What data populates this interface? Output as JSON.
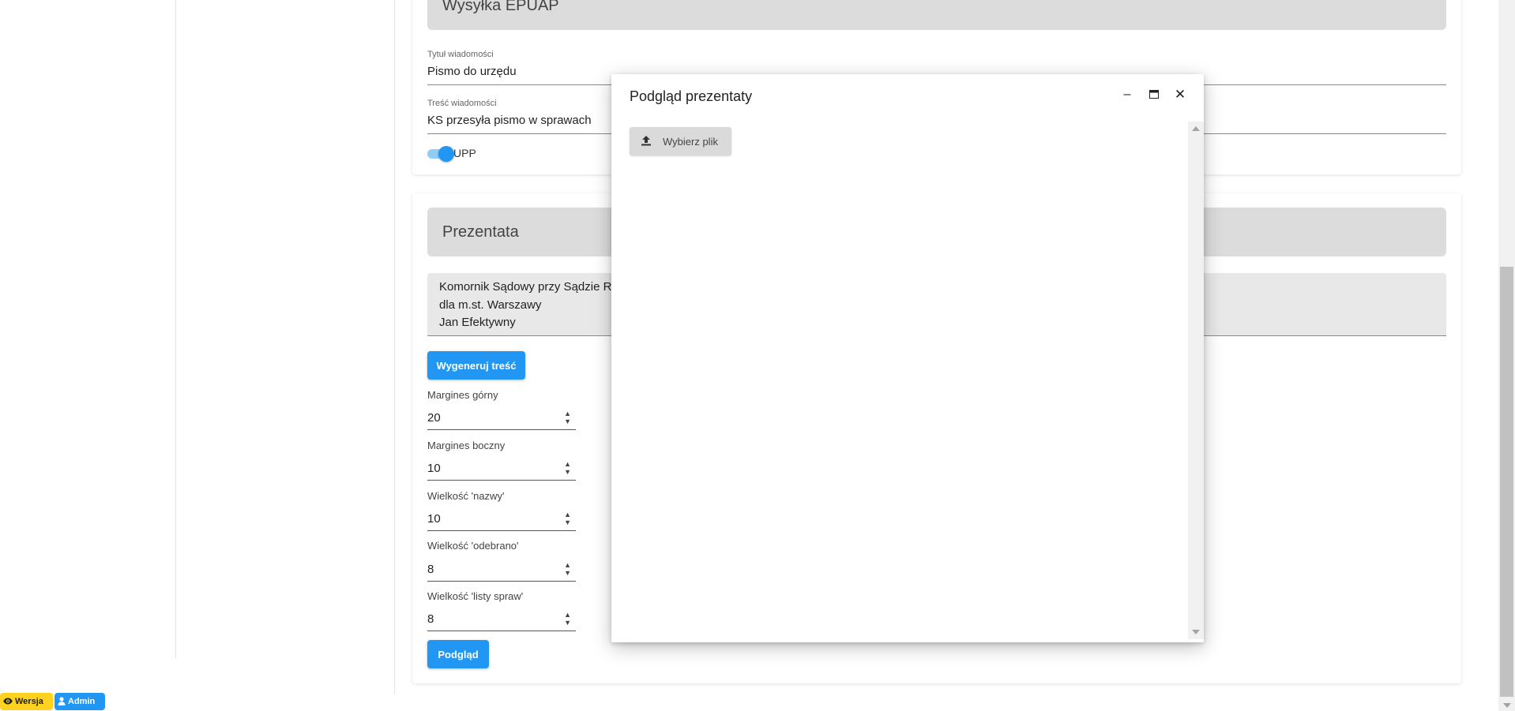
{
  "epuap": {
    "header": "Wysyłka EPUAP",
    "title_label": "Tytuł wiadomości",
    "title_value": "Pismo do urzędu",
    "body_label": "Treść wiadomości",
    "body_value": "KS przesyła pismo w sprawach",
    "upp_label": "UPP",
    "upp_enabled": true
  },
  "prezentata": {
    "header": "Prezentata",
    "address_lines": [
      "Komornik Sądowy przy Sądzie R",
      "dla m.st. Warszawy",
      "Jan Efektywny"
    ],
    "generate_button": "Wygeneruj treść",
    "fields": [
      {
        "label": "Margines górny",
        "value": "20"
      },
      {
        "label": "Margines boczny",
        "value": "10"
      },
      {
        "label": "Wielkość 'nazwy'",
        "value": "10"
      },
      {
        "label": "Wielkość 'odebrano'",
        "value": "8"
      },
      {
        "label": "Wielkość 'listy spraw'",
        "value": "8"
      }
    ],
    "preview_button": "Podgląd"
  },
  "dialog": {
    "title": "Podgląd prezentaty",
    "upload_button": "Wybierz plik",
    "minimize_glyph": "–",
    "maximize_glyph": "🗖",
    "close_glyph": "✕"
  },
  "footer": {
    "version_badge": "Wersja",
    "admin_badge": "Admin"
  },
  "colors": {
    "accent": "#2196f3",
    "header_bg": "#dcdcdc",
    "version_badge": "#ffd21f"
  }
}
